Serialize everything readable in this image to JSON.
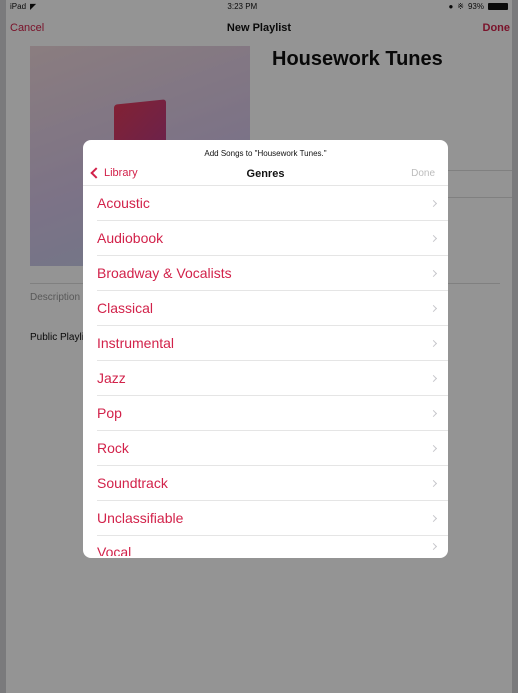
{
  "status_bar": {
    "device": "iPad",
    "time": "3:23 PM",
    "battery": "93%"
  },
  "nav": {
    "cancel": "Cancel",
    "title": "New Playlist",
    "done": "Done"
  },
  "playlist": {
    "name": "Housework Tunes",
    "description_label": "Description",
    "public_label": "Public Playlist"
  },
  "modal": {
    "subtitle": "Add Songs to \"Housework Tunes.\"",
    "back": "Library",
    "title": "Genres",
    "done": "Done",
    "genres": [
      "Acoustic",
      "Audiobook",
      "Broadway & Vocalists",
      "Classical",
      "Instrumental",
      "Jazz",
      "Pop",
      "Rock",
      "Soundtrack",
      "Unclassifiable",
      "Vocal"
    ]
  },
  "colors": {
    "accent": "#d2224a",
    "disabled": "#bcbcbc"
  }
}
